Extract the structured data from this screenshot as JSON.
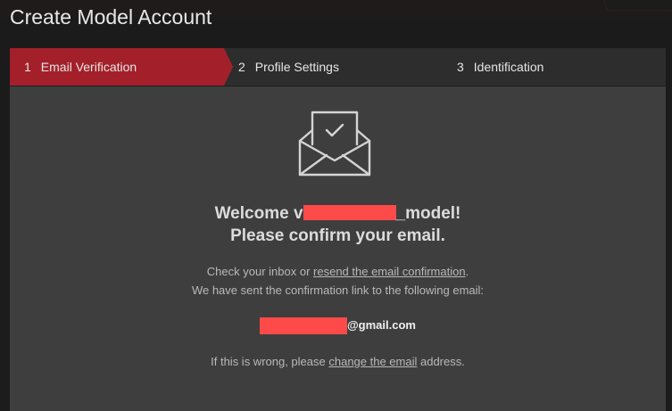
{
  "modal": {
    "title": "Create Model Account"
  },
  "steps": [
    {
      "num": "1",
      "label": "Email Verification",
      "active": true
    },
    {
      "num": "2",
      "label": "Profile Settings",
      "active": false
    },
    {
      "num": "3",
      "label": "Identification",
      "active": false
    }
  ],
  "content": {
    "welcome_prefix": "Welcome ",
    "welcome_visible_start": "v",
    "welcome_underscore": "_",
    "welcome_suffix": "_model!",
    "confirm_heading": "Please confirm your email.",
    "inbox_prefix": "Check your inbox or ",
    "resend_link": "resend the email confirmation",
    "inbox_suffix": ".",
    "sent_text": "We have sent the confirmation link to the following email:",
    "email_domain": "@gmail.com",
    "wrong_prefix": "If this is wrong, please ",
    "change_link": "change the email",
    "wrong_suffix": " address."
  },
  "icons": {
    "envelope": "envelope-check-icon"
  },
  "colors": {
    "accent": "#a3202b",
    "redaction": "#ff4a4a"
  }
}
